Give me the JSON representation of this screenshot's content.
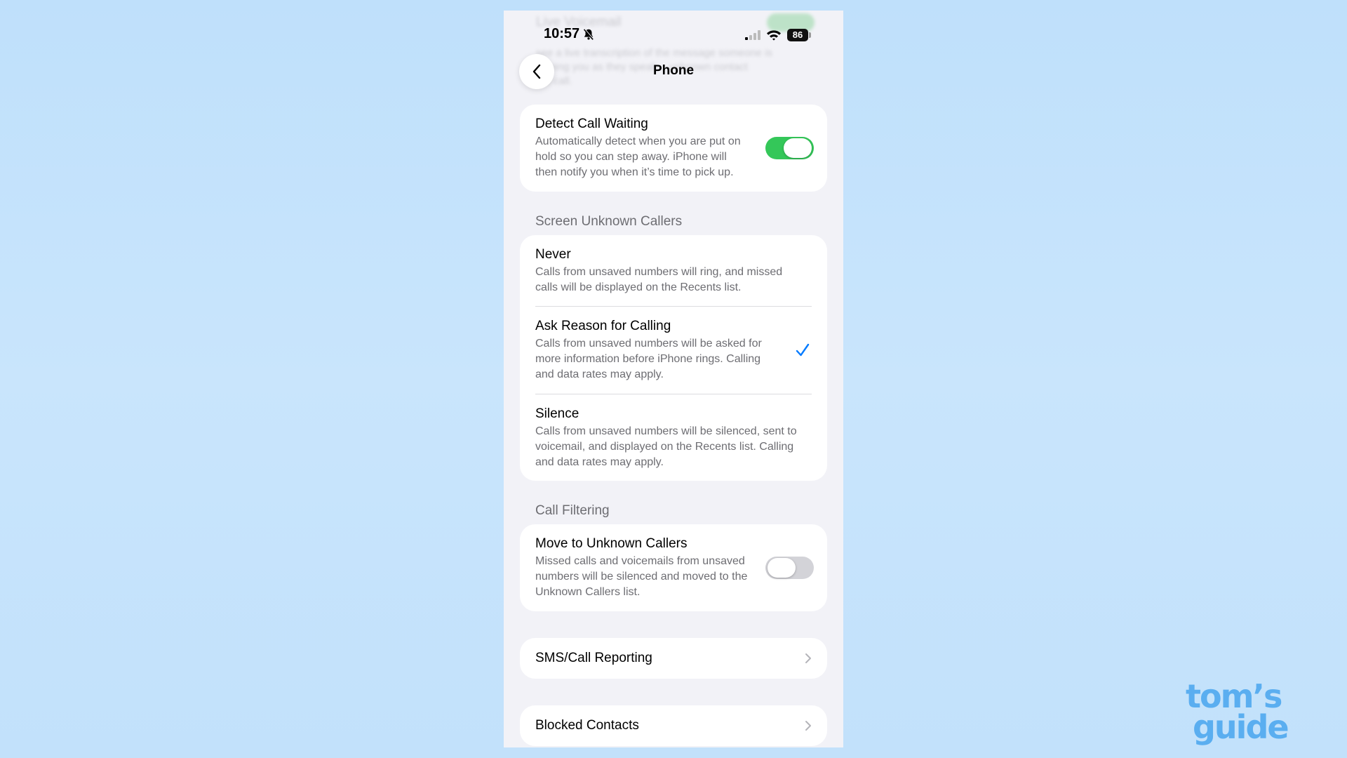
{
  "ghost": {
    "title": "Live Voicemail",
    "line1": "see a live transcription of the message someone is",
    "line2": "leaving you as they speak... unknown contact",
    "line3": "the call."
  },
  "status": {
    "time": "10:57",
    "battery": "86"
  },
  "nav": {
    "title": "Phone"
  },
  "detect_call_waiting": {
    "title": "Detect Call Waiting",
    "description": "Automatically detect when you are put on hold so you can step away. iPhone will then notify you when it’s time to pick up.",
    "enabled": true
  },
  "screen_unknown_callers": {
    "header": "Screen Unknown Callers",
    "options": [
      {
        "title": "Never",
        "description": "Calls from unsaved numbers will ring, and missed calls will be displayed on the Recents list.",
        "selected": false
      },
      {
        "title": "Ask Reason for Calling",
        "description": "Calls from unsaved numbers will be asked for more information before iPhone rings. Calling and data rates may apply.",
        "selected": true
      },
      {
        "title": "Silence",
        "description": "Calls from unsaved numbers will be silenced, sent to voicemail, and displayed on the Recents list. Calling and data rates may apply.",
        "selected": false
      }
    ]
  },
  "call_filtering": {
    "header": "Call Filtering",
    "move_to_unknown": {
      "title": "Move to Unknown Callers",
      "description": "Missed calls and voicemails from unsaved numbers will be silenced and moved to the Unknown Callers list.",
      "enabled": false
    }
  },
  "links": {
    "sms_call_reporting": "SMS/Call Reporting",
    "blocked_contacts": "Blocked Contacts"
  },
  "brand": {
    "line1": "tom’s",
    "line2": "guide"
  },
  "colors": {
    "accent": "#007aff",
    "toggle_on": "#34c759",
    "background": "#f2f2f7"
  }
}
